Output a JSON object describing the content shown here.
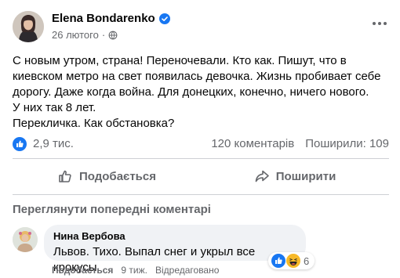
{
  "post": {
    "author": "Elena Bondarenko",
    "date": "26 лютого",
    "separator": "·",
    "text_lines": [
      "С новым утром, страна! Переночевали. Кто как. Пишут, что в",
      "киевском метро на свет появилась девочка. Жизнь пробивает себе",
      "дорогу. Даже когда война. Для донецких, конечно, ничего нового.",
      "У них так 8 лет.",
      "Перекличка. Как обстановка?"
    ]
  },
  "stats": {
    "likes": "2,9 тис.",
    "comments": "120 коментарів",
    "shares": "Поширили: 109"
  },
  "actions": {
    "like": "Подобається",
    "share": "Поширити"
  },
  "prev_comments": "Переглянути попередні коментарі",
  "comment": {
    "author": "Нина Вербова",
    "text": "Львов. Тихо. Выпал снег и укрыл все крокусы",
    "reaction_count": "6",
    "like_action": "Подобається",
    "time": "9 тиж.",
    "status": "Відредаговано"
  },
  "colors": {
    "accent": "#1877f2",
    "secondary_text": "#65676b",
    "bubble": "#f0f2f5"
  }
}
